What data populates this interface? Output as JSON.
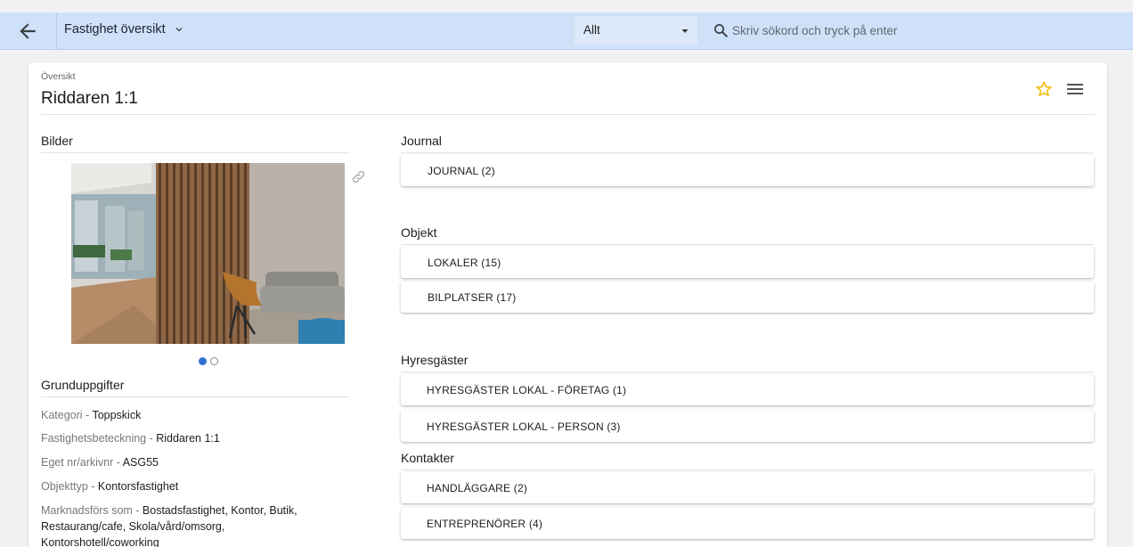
{
  "topbar": {
    "back_icon": "arrow-left-icon",
    "page_selector": "Fastighet översikt",
    "filter_value": "Allt",
    "search_placeholder": "Skriv sökord och tryck på enter"
  },
  "header": {
    "kicker": "Översikt",
    "title": "Riddaren 1:1",
    "favorite_color": "#f2c018"
  },
  "images": {
    "heading": "Bilder",
    "carousel_count": 2,
    "active_index": 0
  },
  "details": {
    "heading": "Grunduppgifter",
    "fields": [
      {
        "label": "Kategori",
        "sep": " - ",
        "value": "Toppskick"
      },
      {
        "label": "Fastighetsbeteckning",
        "sep": " - ",
        "value": "Riddaren 1:1"
      },
      {
        "label": "Eget nr/arkivnr",
        "sep": " - ",
        "value": "ASG55"
      },
      {
        "label": "Objekttyp",
        "sep": " - ",
        "value": "Kontorsfastighet"
      },
      {
        "label": "Marknadsförs som",
        "sep": " - ",
        "value": "Bostadsfastighet, Kontor, Butik, Restaurang/cafe, Skola/vård/omsorg, Kontorshotell/coworking"
      }
    ]
  },
  "sections": {
    "journal": {
      "heading": "Journal",
      "items": [
        "JOURNAL (2)"
      ]
    },
    "objekt": {
      "heading": "Objekt",
      "items": [
        "LOKALER  (15)",
        "BILPLATSER  (17)"
      ]
    },
    "hyresgaster": {
      "heading": "Hyresgäster",
      "items": [
        "HYRESGÄSTER LOKAL - FÖRETAG  (1)",
        "HYRESGÄSTER LOKAL - PERSON  (3)"
      ]
    },
    "kontakter": {
      "heading": "Kontakter",
      "items": [
        "HANDLÄGGARE  (2)",
        "ENTREPRENÖRER  (4)"
      ]
    }
  },
  "colors": {
    "topbar": "#cfe1f8",
    "accent": "#2f6fd0"
  }
}
